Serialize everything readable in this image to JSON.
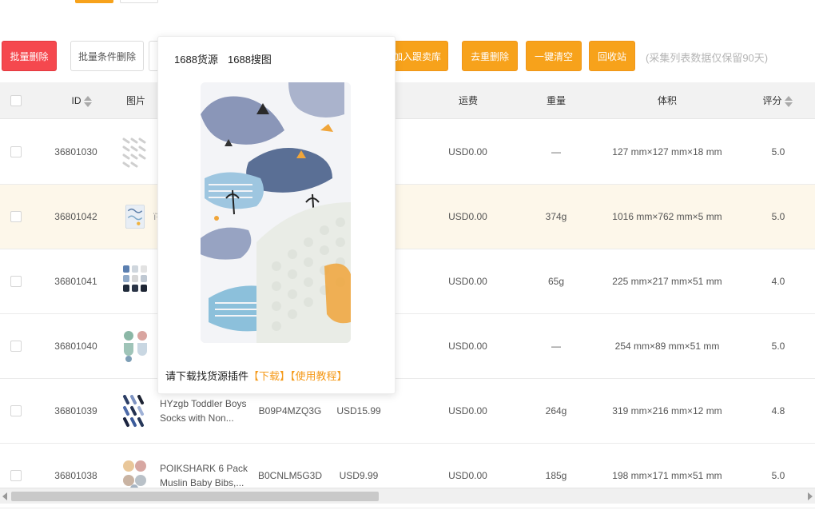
{
  "toolbar": {
    "batch_delete": "批量删除",
    "batch_condition_delete": "批量条件删除",
    "add_to_store": "加入跟卖库",
    "dedupe_delete": "去重删除",
    "clear_all": "一键清空",
    "recycle_bin": "回收站",
    "retention_note": "(采集列表数据仅保留90天)"
  },
  "table": {
    "headers": {
      "id": "ID",
      "image": "图片",
      "shipping": "运费",
      "weight": "重量",
      "volume": "体积",
      "rating": "评分"
    },
    "rows": [
      {
        "id": "36801030",
        "title": "",
        "asin": "",
        "price": "",
        "shipping": "USD0.00",
        "weight": "—",
        "volume": "127 mm×127 mm×18 mm",
        "rating": "5.0"
      },
      {
        "id": "36801042",
        "title": "",
        "asin": "",
        "price": "",
        "shipping": "USD0.00",
        "weight": "374g",
        "volume": "1016 mm×762 mm×5 mm",
        "rating": "5.0"
      },
      {
        "id": "36801041",
        "title": "",
        "asin": "",
        "price": "",
        "shipping": "USD0.00",
        "weight": "65g",
        "volume": "225 mm×217 mm×51 mm",
        "rating": "4.0"
      },
      {
        "id": "36801040",
        "title": "",
        "asin": "",
        "price": "",
        "shipping": "USD0.00",
        "weight": "—",
        "volume": "254 mm×89 mm×51 mm",
        "rating": "5.0"
      },
      {
        "id": "36801039",
        "title": "HYzgb Toddler Boys Socks with Non...",
        "asin": "B09P4MZQ3G",
        "price": "USD15.99",
        "shipping": "USD0.00",
        "weight": "264g",
        "volume": "319 mm×216 mm×12 mm",
        "rating": "4.8"
      },
      {
        "id": "36801038",
        "title": "POIKSHARK 6 Pack Muslin Baby Bibs,...",
        "asin": "B0CNLM5G3D",
        "price": "USD9.99",
        "shipping": "USD0.00",
        "weight": "185g",
        "volume": "198 mm×171 mm×51 mm",
        "rating": "5.0"
      }
    ]
  },
  "popup": {
    "tab_goods": "1688货源",
    "tab_image_search": "1688搜图",
    "footer_prefix": "请下载找货源插件",
    "download_link": "【下载】",
    "tutorial_link": "【使用教程】"
  },
  "colors": {
    "accent_orange": "#f7a21b",
    "danger_red": "#f5484e",
    "highlight_row": "#fdf7ea",
    "link_orange": "#f59a1a"
  }
}
